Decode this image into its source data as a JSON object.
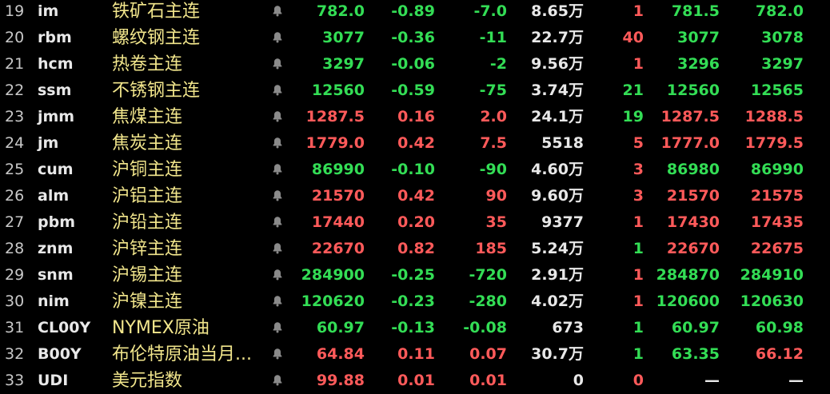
{
  "colors": {
    "background": "#000000",
    "up": "#ff5a5a",
    "down": "#33dd55",
    "name": "#f2e68c",
    "neutral": "#e8e8e8",
    "bell": "#8a8a8a"
  },
  "rows": [
    {
      "idx": "19",
      "code": "im",
      "name": "铁矿石主连",
      "icon": "bell-icon",
      "price": "782.0",
      "change_pct": "-0.89",
      "change": "-7.0",
      "volume": "8.65万",
      "current": "1",
      "bid": "781.5",
      "ask": "782.0",
      "price_dir": "down",
      "chg_dir": "down",
      "cur_dir": "up",
      "bid_dir": "down",
      "ask_dir": "down"
    },
    {
      "idx": "20",
      "code": "rbm",
      "name": "螺纹钢主连",
      "icon": "bell-icon",
      "price": "3077",
      "change_pct": "-0.36",
      "change": "-11",
      "volume": "22.7万",
      "current": "40",
      "bid": "3077",
      "ask": "3078",
      "price_dir": "down",
      "chg_dir": "down",
      "cur_dir": "up",
      "bid_dir": "down",
      "ask_dir": "down"
    },
    {
      "idx": "21",
      "code": "hcm",
      "name": "热卷主连",
      "icon": "bell-icon",
      "price": "3297",
      "change_pct": "-0.06",
      "change": "-2",
      "volume": "9.56万",
      "current": "1",
      "bid": "3296",
      "ask": "3297",
      "price_dir": "down",
      "chg_dir": "down",
      "cur_dir": "up",
      "bid_dir": "down",
      "ask_dir": "down"
    },
    {
      "idx": "22",
      "code": "ssm",
      "name": "不锈钢主连",
      "icon": "bell-icon",
      "price": "12560",
      "change_pct": "-0.59",
      "change": "-75",
      "volume": "3.74万",
      "current": "21",
      "bid": "12560",
      "ask": "12565",
      "price_dir": "down",
      "chg_dir": "down",
      "cur_dir": "down",
      "bid_dir": "down",
      "ask_dir": "down"
    },
    {
      "idx": "23",
      "code": "jmm",
      "name": "焦煤主连",
      "icon": "bell-icon",
      "price": "1287.5",
      "change_pct": "0.16",
      "change": "2.0",
      "volume": "24.1万",
      "current": "19",
      "bid": "1287.5",
      "ask": "1288.5",
      "price_dir": "up",
      "chg_dir": "up",
      "cur_dir": "down",
      "bid_dir": "up",
      "ask_dir": "up"
    },
    {
      "idx": "24",
      "code": "jm",
      "name": "焦炭主连",
      "icon": "bell-icon",
      "price": "1779.0",
      "change_pct": "0.42",
      "change": "7.5",
      "volume": "5518",
      "current": "5",
      "bid": "1777.0",
      "ask": "1779.5",
      "price_dir": "up",
      "chg_dir": "up",
      "cur_dir": "up",
      "bid_dir": "up",
      "ask_dir": "up"
    },
    {
      "idx": "25",
      "code": "cum",
      "name": "沪铜主连",
      "icon": "bell-icon",
      "price": "86990",
      "change_pct": "-0.10",
      "change": "-90",
      "volume": "4.60万",
      "current": "3",
      "bid": "86980",
      "ask": "86990",
      "price_dir": "down",
      "chg_dir": "down",
      "cur_dir": "up",
      "bid_dir": "down",
      "ask_dir": "down"
    },
    {
      "idx": "26",
      "code": "alm",
      "name": "沪铝主连",
      "icon": "bell-icon",
      "price": "21570",
      "change_pct": "0.42",
      "change": "90",
      "volume": "9.60万",
      "current": "3",
      "bid": "21570",
      "ask": "21575",
      "price_dir": "up",
      "chg_dir": "up",
      "cur_dir": "up",
      "bid_dir": "up",
      "ask_dir": "up"
    },
    {
      "idx": "27",
      "code": "pbm",
      "name": "沪铅主连",
      "icon": "bell-icon",
      "price": "17440",
      "change_pct": "0.20",
      "change": "35",
      "volume": "9377",
      "current": "1",
      "bid": "17430",
      "ask": "17435",
      "price_dir": "up",
      "chg_dir": "up",
      "cur_dir": "up",
      "bid_dir": "up",
      "ask_dir": "up"
    },
    {
      "idx": "28",
      "code": "znm",
      "name": "沪锌主连",
      "icon": "bell-icon",
      "price": "22670",
      "change_pct": "0.82",
      "change": "185",
      "volume": "5.24万",
      "current": "1",
      "bid": "22670",
      "ask": "22675",
      "price_dir": "up",
      "chg_dir": "up",
      "cur_dir": "down",
      "bid_dir": "up",
      "ask_dir": "up"
    },
    {
      "idx": "29",
      "code": "snm",
      "name": "沪锡主连",
      "icon": "bell-icon",
      "price": "284900",
      "change_pct": "-0.25",
      "change": "-720",
      "volume": "2.91万",
      "current": "1",
      "bid": "284870",
      "ask": "284910",
      "price_dir": "down",
      "chg_dir": "down",
      "cur_dir": "up",
      "bid_dir": "down",
      "ask_dir": "down"
    },
    {
      "idx": "30",
      "code": "nim",
      "name": "沪镍主连",
      "icon": "bell-icon",
      "price": "120620",
      "change_pct": "-0.23",
      "change": "-280",
      "volume": "4.02万",
      "current": "1",
      "bid": "120600",
      "ask": "120630",
      "price_dir": "down",
      "chg_dir": "down",
      "cur_dir": "up",
      "bid_dir": "down",
      "ask_dir": "down"
    },
    {
      "idx": "31",
      "code": "CL00Y",
      "name": "NYMEX原油",
      "icon": "bell-icon",
      "price": "60.97",
      "change_pct": "-0.13",
      "change": "-0.08",
      "volume": "673",
      "current": "1",
      "bid": "60.97",
      "ask": "60.98",
      "price_dir": "down",
      "chg_dir": "down",
      "cur_dir": "down",
      "bid_dir": "down",
      "ask_dir": "down"
    },
    {
      "idx": "32",
      "code": "B00Y",
      "name": "布伦特原油当月...",
      "icon": "bell-icon",
      "price": "64.84",
      "change_pct": "0.11",
      "change": "0.07",
      "volume": "30.7万",
      "current": "1",
      "bid": "63.35",
      "ask": "66.12",
      "price_dir": "up",
      "chg_dir": "up",
      "cur_dir": "down",
      "bid_dir": "down",
      "ask_dir": "up"
    },
    {
      "idx": "33",
      "code": "UDI",
      "name": "美元指数",
      "icon": "bell-icon",
      "price": "99.88",
      "change_pct": "0.01",
      "change": "0.01",
      "volume": "0",
      "current": "0",
      "bid": "—",
      "ask": "—",
      "price_dir": "up",
      "chg_dir": "up",
      "cur_dir": "up",
      "bid_dir": "flat",
      "ask_dir": "flat"
    }
  ]
}
